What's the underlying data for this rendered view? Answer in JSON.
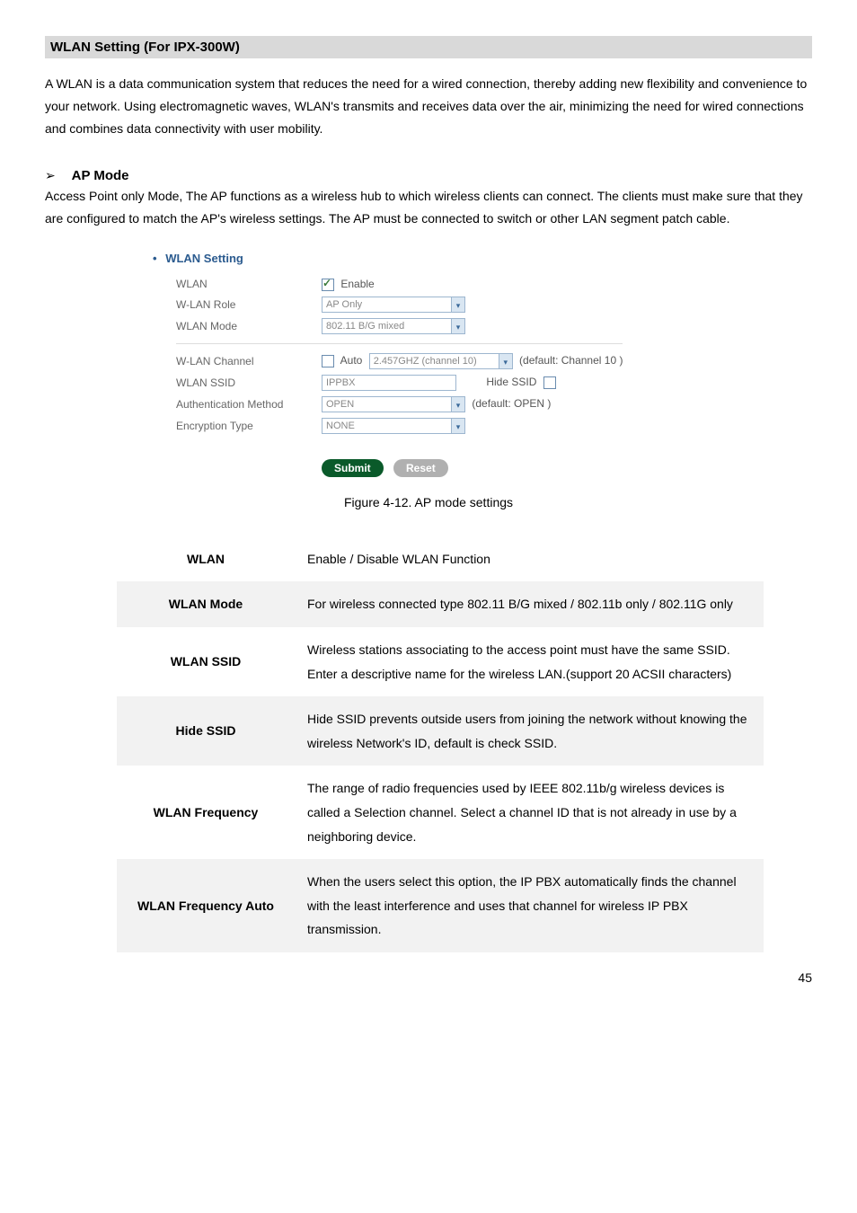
{
  "header": {
    "title": "WLAN Setting (For IPX-300W)"
  },
  "intro": "A WLAN is a data communication system that reduces the need for a wired connection, thereby adding new flexibility and convenience to your network. Using electromagnetic waves, WLAN's transmits and receives data over the air, minimizing the need for wired connections and combines data connectivity with user mobility.",
  "apmode": {
    "arrow": "➢",
    "title": "AP Mode",
    "desc": "Access Point only Mode, The AP functions as a wireless hub to which wireless clients can connect. The clients must make sure that they are configured to match the AP's wireless settings. The AP must be connected to switch or other LAN segment patch cable."
  },
  "figure": {
    "panel_title": "WLAN Setting",
    "rows": {
      "wlan_label": "WLAN",
      "wlan_enable": "Enable",
      "role_label": "W-LAN Role",
      "role_value": "AP Only",
      "mode_label": "WLAN Mode",
      "mode_value": "802.11 B/G mixed",
      "chan_label": "W-LAN Channel",
      "chan_auto": "Auto",
      "chan_value": "2.457GHZ (channel 10)",
      "chan_default": "(default: Channel 10 )",
      "ssid_label": "WLAN SSID",
      "ssid_value": "IPPBX",
      "hide_ssid": "Hide SSID",
      "auth_label": "Authentication Method",
      "auth_value": "OPEN",
      "auth_default": "(default: OPEN )",
      "enc_label": "Encryption Type",
      "enc_value": "NONE"
    },
    "buttons": {
      "submit": "Submit",
      "reset": "Reset"
    },
    "caption": "Figure 4-12. AP mode settings"
  },
  "table": [
    {
      "key": "WLAN",
      "val": "Enable / Disable WLAN Function",
      "shaded": false
    },
    {
      "key": "WLAN Mode",
      "val": "For wireless connected type 802.11 B/G mixed / 802.11b only / 802.11G only",
      "shaded": true
    },
    {
      "key": "WLAN SSID",
      "val": "Wireless stations associating to the access point must have the same SSID. Enter a descriptive name for the wireless LAN.(support 20 ACSII characters)",
      "shaded": false
    },
    {
      "key": "Hide SSID",
      "val": "Hide SSID prevents outside users from joining the network without knowing the wireless Network's ID, default is check SSID.",
      "shaded": true
    },
    {
      "key": "WLAN Frequency",
      "val": "The range of radio frequencies used by IEEE 802.11b/g wireless devices is called a Selection channel. Select a channel ID that is not already in use by a neighboring device.",
      "shaded": false
    },
    {
      "key": "WLAN Frequency Auto",
      "val": "When the users select this option, the IP PBX automatically finds the channel with the least interference and uses that channel for wireless IP PBX transmission.",
      "shaded": true
    }
  ],
  "page": "45"
}
